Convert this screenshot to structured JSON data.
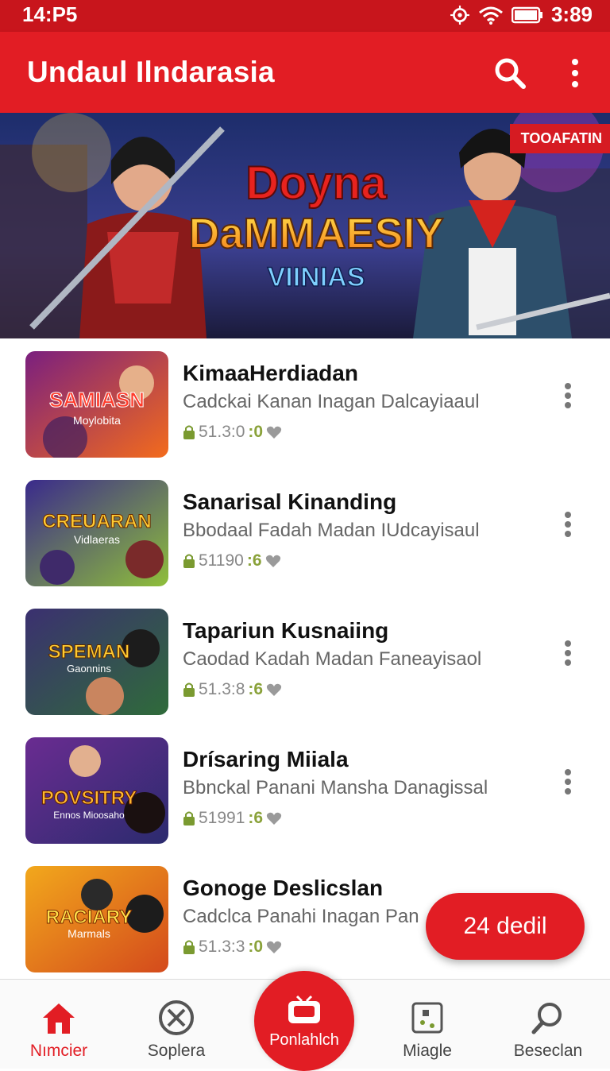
{
  "status": {
    "time_left": "14:P5",
    "time_right": "3:89"
  },
  "app": {
    "title": "Undaul Ilndarasia"
  },
  "banner": {
    "tag": "TOOAFATIN",
    "title_line1": "Doyna",
    "title_line2": "DaMMAESIY",
    "title_line3": "VIINIAS"
  },
  "games": [
    {
      "name": "KimaaHerdiadan",
      "desc": "Cadckai Kanan Inagan Dalcayiaaul",
      "rating": "51.3:0",
      "badge": ":0",
      "thumb_title": "SAMIASN",
      "thumb_sub": "Moylobita",
      "thumb_colors": [
        "#f36b1c",
        "#7a1f7f"
      ]
    },
    {
      "name": "Sanarisal Kinanding",
      "desc": "Bbodaal Fadah Madan IUdcayisaul",
      "rating": "51190",
      "badge": ":6",
      "thumb_title": "CREUARAN",
      "thumb_sub": "Vidlaeras",
      "thumb_colors": [
        "#3a2a8c",
        "#8fbf3a"
      ]
    },
    {
      "name": "Tapariun Kusnaiing",
      "desc": "Caodad Kadah Madan Faneayisaol",
      "rating": "51.3:8",
      "badge": ":6",
      "thumb_title": "SPEMAN",
      "thumb_sub": "Gaonnins",
      "thumb_colors": [
        "#3b3070",
        "#2f6b3a"
      ]
    },
    {
      "name": "Drísaring Miiala",
      "desc": "Bbnckal Panani Mansha Danagissal",
      "rating": "51991",
      "badge": ":6",
      "thumb_title": "POVSITRY",
      "thumb_sub": "Ennos Mioosaho",
      "thumb_colors": [
        "#6a2c91",
        "#2b2b6e"
      ]
    },
    {
      "name": "Gonoge Deslicslan",
      "desc": "Cadclca Panahi Inagan Pan",
      "rating": "51.3:3",
      "badge": ":0",
      "thumb_title": "RACIARY",
      "thumb_sub": "Marmals",
      "thumb_colors": [
        "#f2a81c",
        "#d44a1c"
      ]
    }
  ],
  "fab": {
    "label": "24 dedil"
  },
  "nav": {
    "items": [
      {
        "label": "Nımcier"
      },
      {
        "label": "Soplera"
      },
      {
        "label": "Ponlahlch"
      },
      {
        "label": "Miagle"
      },
      {
        "label": "Beseclan"
      }
    ]
  },
  "colors": {
    "brand": "#e21d24",
    "status": "#c8151c",
    "accent_green": "#8aa23a"
  },
  "icons": [
    "search-icon",
    "more-vert-icon",
    "home-icon",
    "close-circle-icon",
    "tv-icon",
    "dice-icon",
    "search-icon",
    "lock-icon",
    "heart-icon"
  ]
}
